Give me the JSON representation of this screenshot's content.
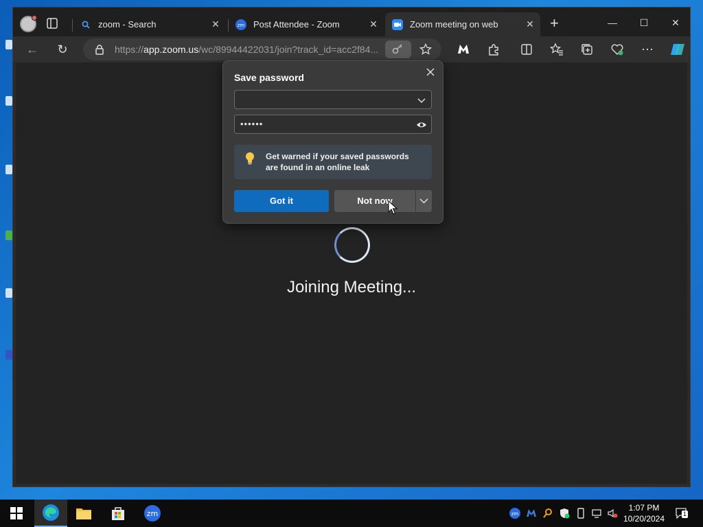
{
  "browser": {
    "tabs": [
      {
        "title": "zoom - Search",
        "icon": "search-icon"
      },
      {
        "title": "Post Attendee - Zoom",
        "icon": "zoom-logo-icon"
      },
      {
        "title": "Zoom meeting on web",
        "icon": "zoom-camera-icon",
        "active": true
      }
    ],
    "new_tab": "+",
    "address": {
      "prefix": "https://",
      "domain": "app.zoom.us",
      "path": "/wc/89944422031/join?track_id=acc2f84..."
    }
  },
  "page": {
    "status_text": "Joining Meeting..."
  },
  "password_dialog": {
    "title": "Save password",
    "username_value": "",
    "password_value": "••••••",
    "info_text": "Get warned if your saved passwords are found in an online leak",
    "primary_button": "Got it",
    "secondary_button": "Not now"
  },
  "taskbar": {
    "time": "1:07 PM",
    "date": "10/20/2024",
    "notification_count": "1"
  },
  "colors": {
    "accent": "#0f6cbd",
    "desktop": "#1a6fc2",
    "page_background": "#232323"
  }
}
